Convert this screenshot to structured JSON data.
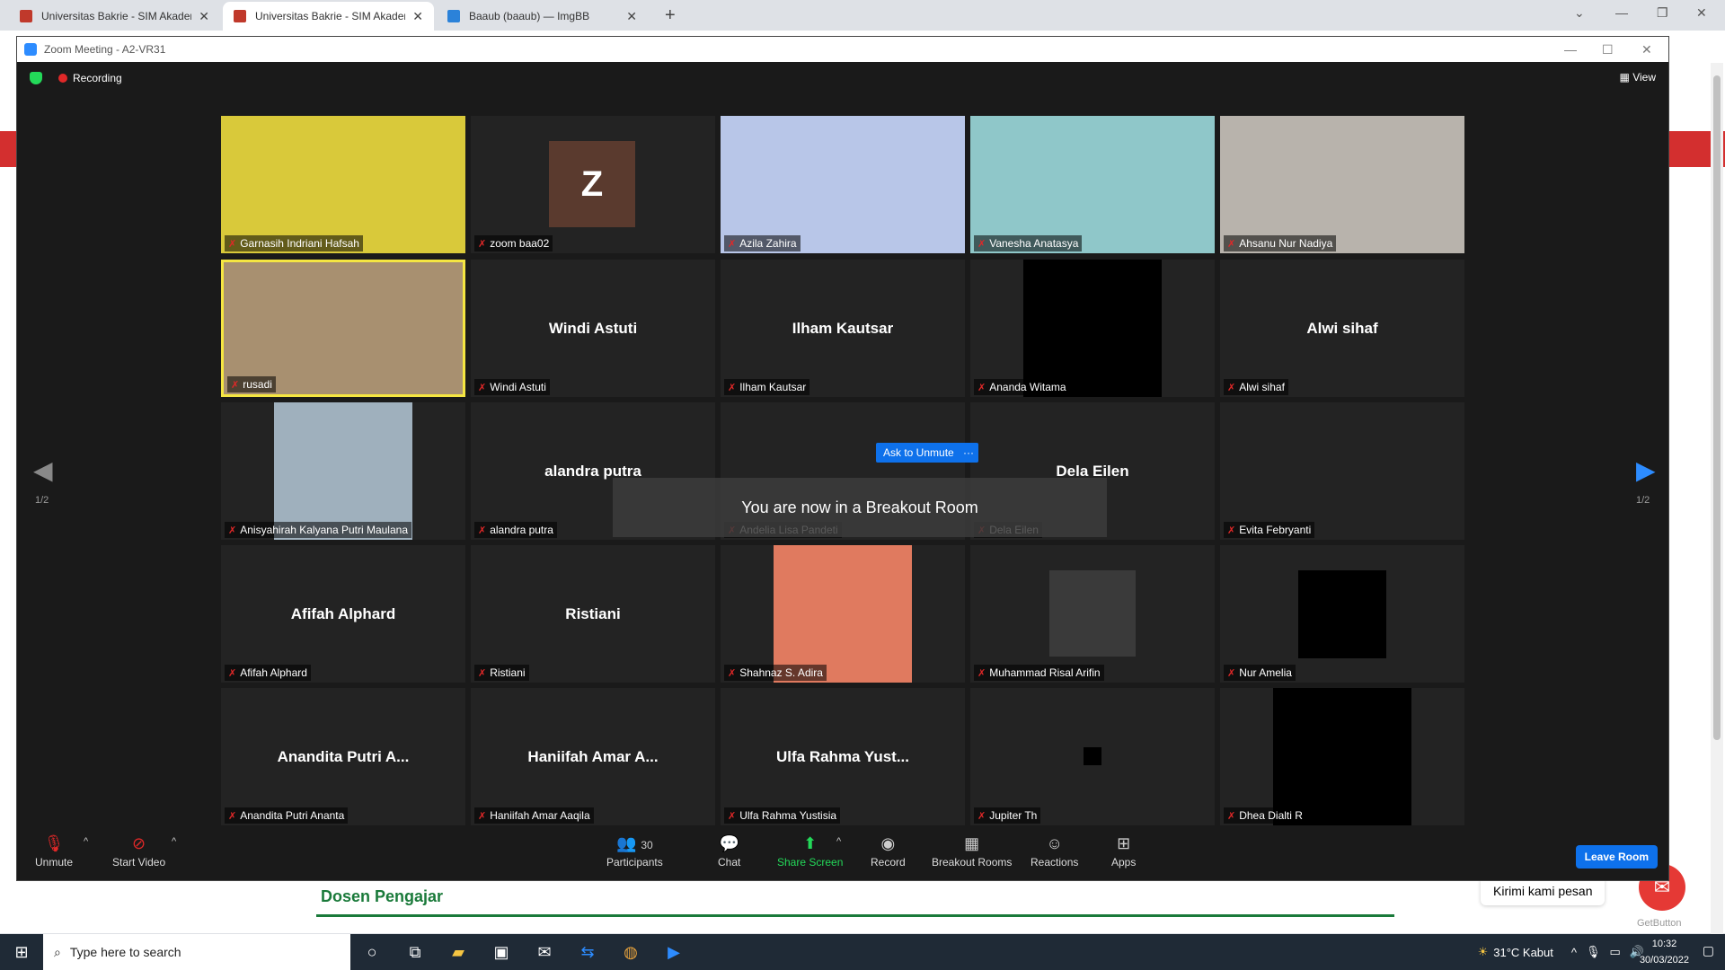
{
  "browser": {
    "tabs": [
      {
        "title": "Universitas Bakrie - SIM Akadem",
        "active": false
      },
      {
        "title": "Universitas Bakrie - SIM Akadem",
        "active": true
      },
      {
        "title": "Baaub (baaub) — ImgBB",
        "active": false
      }
    ],
    "new_tab": "+"
  },
  "page": {
    "dosen_heading": "Dosen Pengajar",
    "chat_bubble": "Kirimi kami pesan",
    "getbutton": "GetButton"
  },
  "zoom": {
    "window_title": "Zoom Meeting - A2-VR31",
    "recording": "Recording",
    "view": "View",
    "ask_to_unmute": "Ask to Unmute",
    "more": "···",
    "breakout_msg": "You are now in a Breakout Room",
    "page_left": "1/2",
    "page_right": "1/2",
    "tiles": [
      {
        "name": "Garnasih Indriani Hafsah",
        "big": "",
        "kind": "photo",
        "color": "#d9c93a"
      },
      {
        "name": "zoom baa02",
        "big": "",
        "kind": "avatar",
        "letter": "Z"
      },
      {
        "name": "Azila Zahira",
        "big": "",
        "kind": "photo",
        "color": "#b8c6e8"
      },
      {
        "name": "Vanesha Anatasya",
        "big": "",
        "kind": "photo",
        "color": "#8fc7c9"
      },
      {
        "name": "Ahsanu Nur Nadiya",
        "big": "",
        "kind": "photo",
        "color": "#b8b3ac"
      },
      {
        "name": "rusadi",
        "big": "",
        "kind": "photo",
        "color": "#a89070"
      },
      {
        "name": "Windi Astuti",
        "big": "Windi Astuti",
        "kind": "text"
      },
      {
        "name": "Ilham Kautsar",
        "big": "Ilham Kautsar",
        "kind": "text"
      },
      {
        "name": "Ananda Witama",
        "big": "",
        "kind": "black"
      },
      {
        "name": "Alwi sihaf",
        "big": "Alwi sihaf",
        "kind": "text"
      },
      {
        "name": "Anisyahirah Kalyana Putri Maulana",
        "big": "",
        "kind": "photo",
        "color": "#9fb0bd"
      },
      {
        "name": "alandra putra",
        "big": "alandra putra",
        "kind": "text"
      },
      {
        "name": "Andelia Lisa Pandeti",
        "big": "",
        "kind": "text"
      },
      {
        "name": "Dela Eilen",
        "big": "Dela Eilen",
        "kind": "text"
      },
      {
        "name": "Evita Febryanti",
        "big": "",
        "kind": "text"
      },
      {
        "name": "Afifah Alphard",
        "big": "Afifah Alphard",
        "kind": "text"
      },
      {
        "name": "Ristiani",
        "big": "Ristiani",
        "kind": "text"
      },
      {
        "name": "Shahnaz S. Adira",
        "big": "",
        "kind": "photo",
        "color": "#e07a5f"
      },
      {
        "name": "Muhammad Risal Arifin",
        "big": "",
        "kind": "photo",
        "color": "#3a3a3a"
      },
      {
        "name": "Nur Amelia",
        "big": "",
        "kind": "black"
      },
      {
        "name": "Anandita Putri Ananta",
        "big": "Anandita Putri A...",
        "kind": "text"
      },
      {
        "name": "Haniifah Amar Aaqila",
        "big": "Haniifah Amar A...",
        "kind": "text"
      },
      {
        "name": "Ulfa Rahma Yustisia",
        "big": "Ulfa Rahma Yust...",
        "kind": "text"
      },
      {
        "name": "Jupiter Th",
        "big": "",
        "kind": "text"
      },
      {
        "name": "Dhea Dialti R",
        "big": "",
        "kind": "black"
      }
    ],
    "toolbar": {
      "unmute": "Unmute",
      "start_video": "Start Video",
      "participants": "Participants",
      "participants_count": "30",
      "chat": "Chat",
      "share_screen": "Share Screen",
      "record": "Record",
      "breakout_rooms": "Breakout Rooms",
      "reactions": "Reactions",
      "apps": "Apps",
      "leave_room": "Leave Room"
    }
  },
  "taskbar": {
    "search_placeholder": "Type here to search",
    "weather": "31°C  Kabut",
    "time": "10:32",
    "date": "30/03/2022"
  }
}
